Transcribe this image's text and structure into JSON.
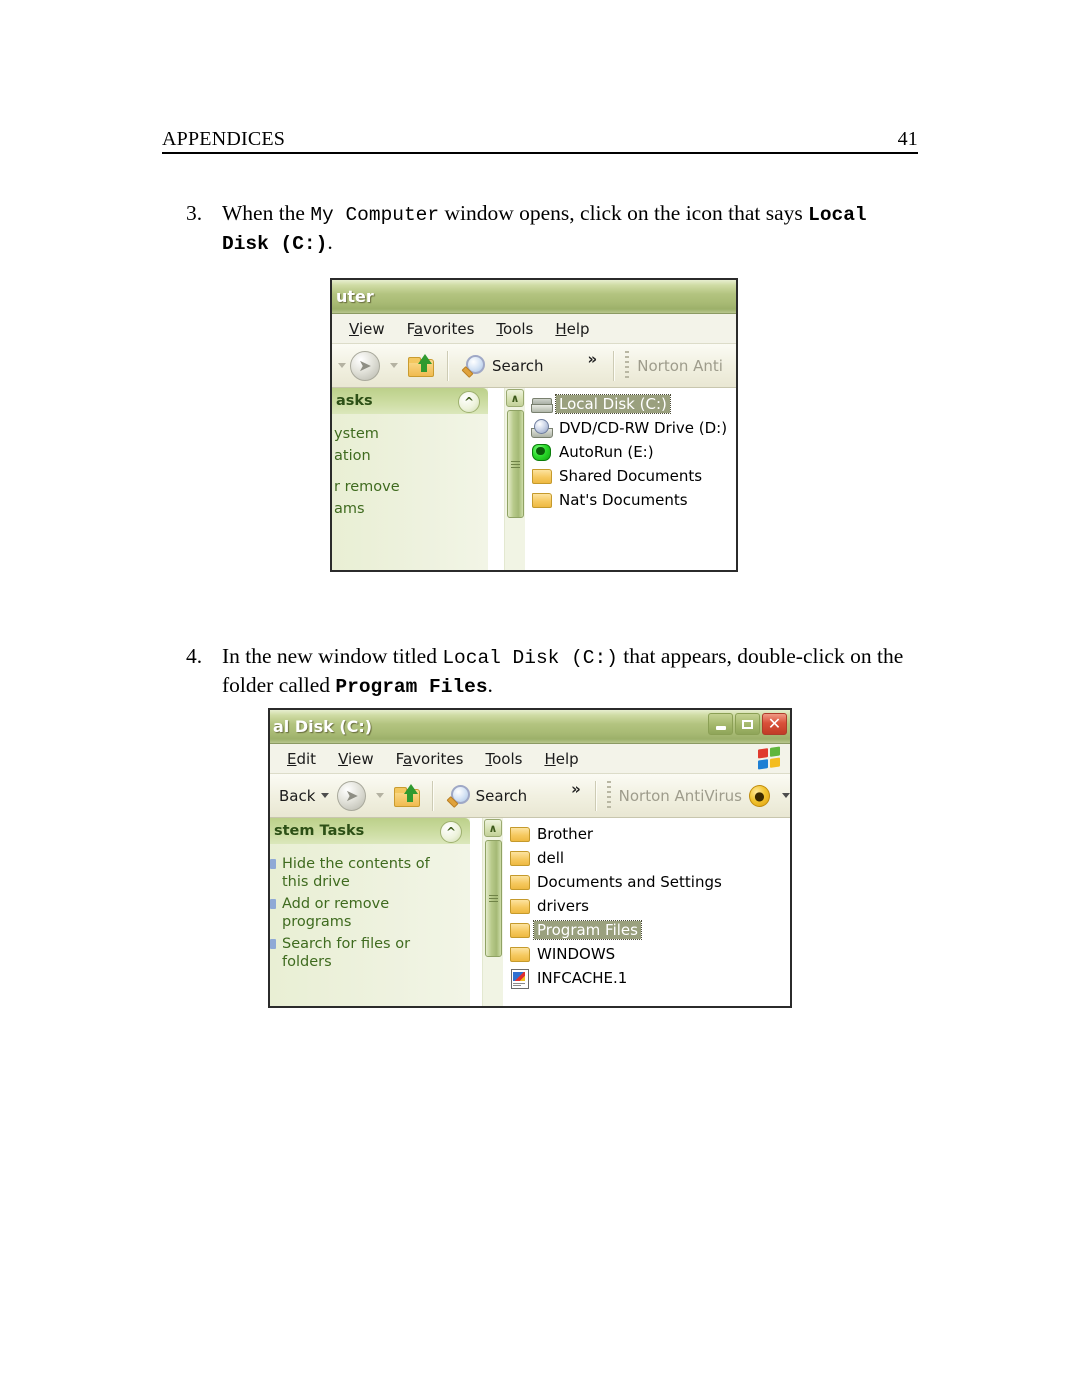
{
  "page": {
    "header_title": "APPENDICES",
    "page_number": "41"
  },
  "steps": [
    {
      "number": "3.",
      "text_part1": "When the ",
      "mono1": "My Computer",
      "text_part2": " window opens, click on the icon that says ",
      "monob1": "Local Disk (C:)",
      "text_part3": "."
    },
    {
      "number": "4.",
      "text_part1": "In the new window titled ",
      "mono1": "Local Disk (C:)",
      "text_part2": " that appears, double-click on the folder called ",
      "monob1": "Program Files",
      "text_part3": "."
    }
  ],
  "window1": {
    "title": "uter",
    "menu": [
      {
        "pre": "",
        "key": "V",
        "post": "iew"
      },
      {
        "pre": "F",
        "key": "a",
        "post": "vorites"
      },
      {
        "pre": "",
        "key": "T",
        "post": "ools"
      },
      {
        "pre": "",
        "key": "H",
        "post": "elp"
      }
    ],
    "toolbar": {
      "search_label": "Search",
      "chevrons": "»",
      "norton_label": "Norton Anti"
    },
    "sidebar": {
      "header": "asks",
      "items": [
        "ystem",
        "ation",
        "r remove",
        "ams"
      ]
    },
    "files": [
      {
        "name": "Local Disk (C:)",
        "icon": "drive-icon",
        "selected": true
      },
      {
        "name": "DVD/CD-RW Drive (D:)",
        "icon": "cd-drive-icon",
        "selected": false
      },
      {
        "name": "AutoRun (E:)",
        "icon": "autorun-icon",
        "selected": false
      },
      {
        "name": "Shared Documents",
        "icon": "folder-icon",
        "selected": false
      },
      {
        "name": "Nat's Documents",
        "icon": "folder-icon",
        "selected": false
      }
    ],
    "scrollbar": {
      "up_arrow": "∧"
    }
  },
  "window2": {
    "title": "al Disk (C:)",
    "window_controls": {
      "minimize": "_",
      "maximize": "□",
      "close": "✕"
    },
    "menu": [
      {
        "pre": "",
        "key": "E",
        "post": "dit"
      },
      {
        "pre": "",
        "key": "V",
        "post": "iew"
      },
      {
        "pre": "F",
        "key": "a",
        "post": "vorites"
      },
      {
        "pre": "",
        "key": "T",
        "post": "ools"
      },
      {
        "pre": "",
        "key": "H",
        "post": "elp"
      }
    ],
    "toolbar": {
      "back_label": "Back",
      "search_label": "Search",
      "chevrons": "»",
      "norton_label": "Norton AntiVirus"
    },
    "sidebar": {
      "header": "stem Tasks",
      "items": [
        "Hide the contents of this drive",
        "Add or remove programs",
        "Search for files or folders"
      ]
    },
    "files": [
      {
        "name": "Brother",
        "icon": "folder-icon",
        "selected": false
      },
      {
        "name": "dell",
        "icon": "folder-icon",
        "selected": false
      },
      {
        "name": "Documents and Settings",
        "icon": "folder-icon",
        "selected": false
      },
      {
        "name": "drivers",
        "icon": "folder-icon",
        "selected": false
      },
      {
        "name": "Program Files",
        "icon": "folder-icon",
        "selected": true
      },
      {
        "name": "WINDOWS",
        "icon": "folder-icon",
        "selected": false
      },
      {
        "name": "INFCACHE.1",
        "icon": "file-icon",
        "selected": false
      }
    ],
    "scrollbar": {
      "up_arrow": "∧"
    }
  },
  "colors": {
    "titlebar_green": "#a8ba74",
    "sidebar_green": "#e9efd4",
    "selection_gray": "#9aa07e",
    "close_red": "#d9503a",
    "folder_yellow": "#f6c960"
  }
}
